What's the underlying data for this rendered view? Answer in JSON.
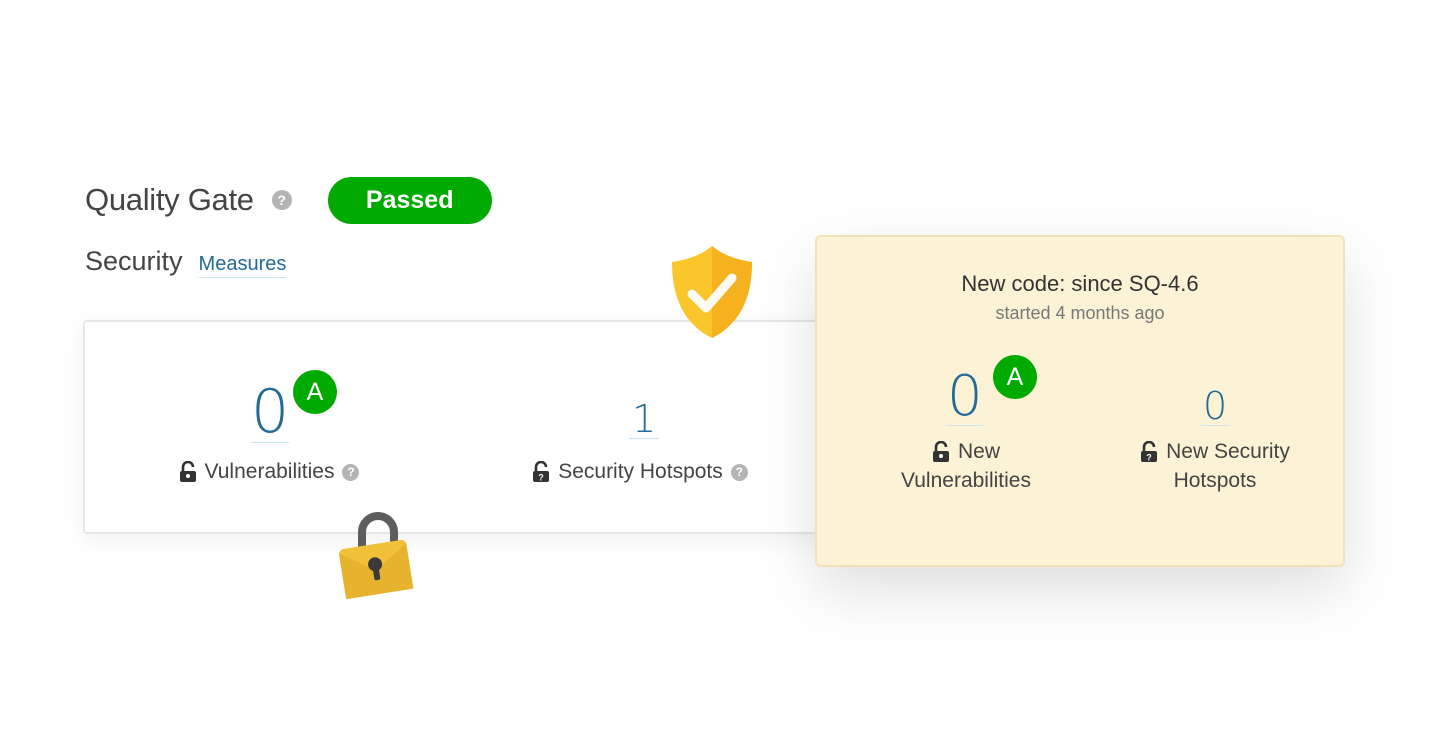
{
  "quality_gate": {
    "title": "Quality Gate",
    "help_glyph": "?",
    "status": "Passed",
    "status_color": "#00aa00"
  },
  "security": {
    "title": "Security",
    "measures_link": "Measures"
  },
  "overall": {
    "vulnerabilities": {
      "value": "0",
      "rating": "A",
      "label": "Vulnerabilities",
      "icon": "lock-open-icon"
    },
    "hotspots": {
      "value": "1",
      "label": "Security Hotspots",
      "icon": "lock-question-icon"
    }
  },
  "new_code": {
    "title": "New code: since SQ-4.6",
    "subtitle": "started 4 months ago",
    "vulnerabilities": {
      "value": "0",
      "rating": "A",
      "label_line1": "New",
      "label_line2": "Vulnerabilities",
      "icon": "lock-open-icon"
    },
    "hotspots": {
      "value": "0",
      "label_line1": "New Security",
      "label_line2": "Hotspots",
      "icon": "lock-question-icon"
    }
  },
  "colors": {
    "link": "#236a97",
    "rating_a": "#00aa00",
    "new_code_bg": "#fcf3d6"
  },
  "decorations": [
    "shield-check-icon",
    "padlock-icon"
  ]
}
